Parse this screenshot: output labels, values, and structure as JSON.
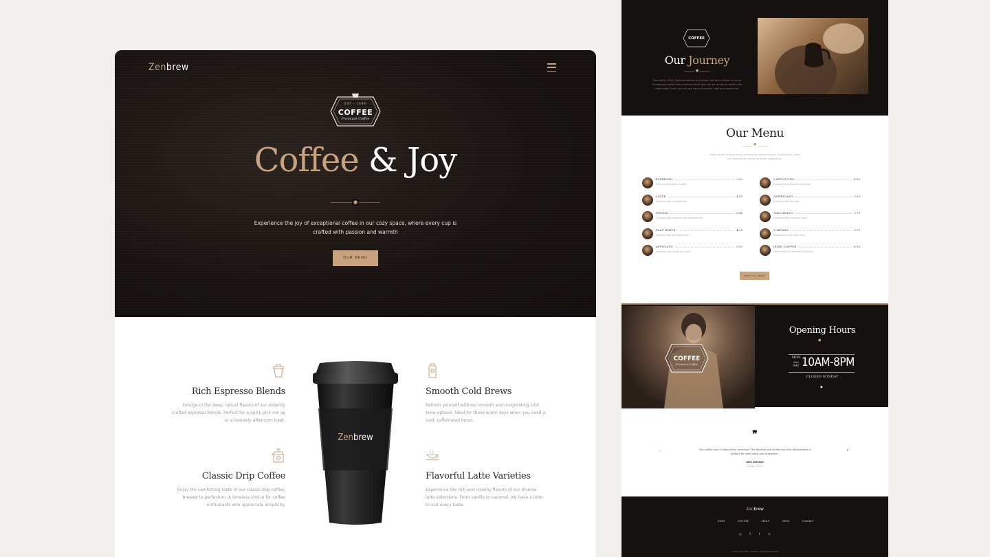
{
  "colors": {
    "accent": "#c9a27e",
    "dark": "#161210",
    "page_bg": "#f0efec"
  },
  "brand": {
    "part1": "Zen",
    "part2": "brew"
  },
  "badge": {
    "est": "EST · 1989",
    "title": "COFFEE",
    "subtitle": "Premium Coffee"
  },
  "hero": {
    "title_part1": "Coffee",
    "title_part2": "& Joy",
    "subtitle": "Experience the joy of exceptional coffee in our cozy space, where every cup is crafted with passion and warmth",
    "button": "OUR MENU",
    "menu_icon": "hamburger-icon"
  },
  "features": [
    {
      "icon": "espresso-icon",
      "title": "Rich Espresso Blends",
      "text": "Indulge in the deep, robust flavors of our expertly crafted espresso blends. Perfect for a quick pick me up or a leisurely afternoon treat."
    },
    {
      "icon": "coffee-grinder-icon",
      "title": "Classic Drip Coffee",
      "text": "Enjoy the comforting taste of our classic drip coffee, brewed to perfection. A timeless choice for coffee enthusiasts who appreciate simplicity."
    },
    {
      "icon": "cold-brew-icon",
      "title": "Smooth Cold Brews",
      "text": "Refresh yourself with our smooth and invigorating cold brew options. Ideal for those warm days when you need a cool, caffeinated boost."
    },
    {
      "icon": "latte-cup-icon",
      "title": "Flavorful Latte Varieties",
      "text": "Experience the rich and creamy flavors of our diverse latte selections. From vanilla to caramel, we have a latte to suit every taste."
    }
  ],
  "cup": {
    "brand_part1": "Zen",
    "brand_part2": "brew"
  },
  "journey": {
    "title_part1": "Our",
    "title_part2": "Journey",
    "text": "Founded in 2010, Zenbrew started as a single cart with a dream to serve exceptional coffee. Now a beloved local spot, we are driven by quality and community. Every cup tells our story of passion, craft and connection."
  },
  "menu": {
    "title": "Our Menu",
    "subtitle": "Lorem ipsum dolor sit amet, consectetur adipiscing elit. Ut elit tellus, luctus nec ullamcorper mattis, pulvinar dapibus leo.",
    "items": [
      {
        "name": "ESPRESSO",
        "price": "3.50",
        "desc": "Rich and bold shot of coffee"
      },
      {
        "name": "LATTE",
        "price": "4.50",
        "desc": "Espresso with steamed milk"
      },
      {
        "name": "MOCHA",
        "price": "5.40",
        "desc": "Espresso with chocolate and steamed milk"
      },
      {
        "name": "FLAT WHITE",
        "price": "4.25",
        "desc": "Espresso with microfoam milk"
      },
      {
        "name": "AFFOGATO",
        "price": "5.50",
        "desc": "Espresso over vanilla ice cream"
      },
      {
        "name": "CAPPUCCINO",
        "price": "4.50",
        "desc": "Espresso with steamed milk foam"
      },
      {
        "name": "AMERICANO",
        "price": "3.50",
        "desc": "Espresso with hot water"
      },
      {
        "name": "MACCHIATO",
        "price": "3.75",
        "desc": "Espresso with a dollop of foam"
      },
      {
        "name": "CORTADO",
        "price": "3.75",
        "desc": "Espresso cut with warm milk"
      },
      {
        "name": "IRISH COFFEE",
        "price": "6.50",
        "desc": "Coffee with Irish whiskey and cream"
      }
    ],
    "button": "VIEW FULL MENU"
  },
  "hours": {
    "title": "Opening Hours",
    "day_from": "MON",
    "day_sep": "thru",
    "day_to": "SAT",
    "time": "10AM-8PM",
    "closed": "CLOSED SUNDAY"
  },
  "testimonial": {
    "quote_mark": "❞",
    "text": "The coffee here is absolutely amazing! The baristas are skilled and the atmosphere is perfect for both work and relaxation.",
    "name": "Alex Johnson",
    "role": "Frequent Visitor",
    "prev": "‹",
    "next": "›"
  },
  "footer": {
    "nav": [
      "HOME",
      "EXPLORE",
      "ABOUT",
      "MENU",
      "CONTACT"
    ],
    "social": [
      "instagram-icon",
      "facebook-icon",
      "twitter-icon",
      "pinterest-icon"
    ],
    "social_glyphs": [
      "◎",
      "f",
      "t",
      "℗"
    ],
    "copyright": "© Copyright 2024 - Zenbrew. All Rights Reserved."
  }
}
